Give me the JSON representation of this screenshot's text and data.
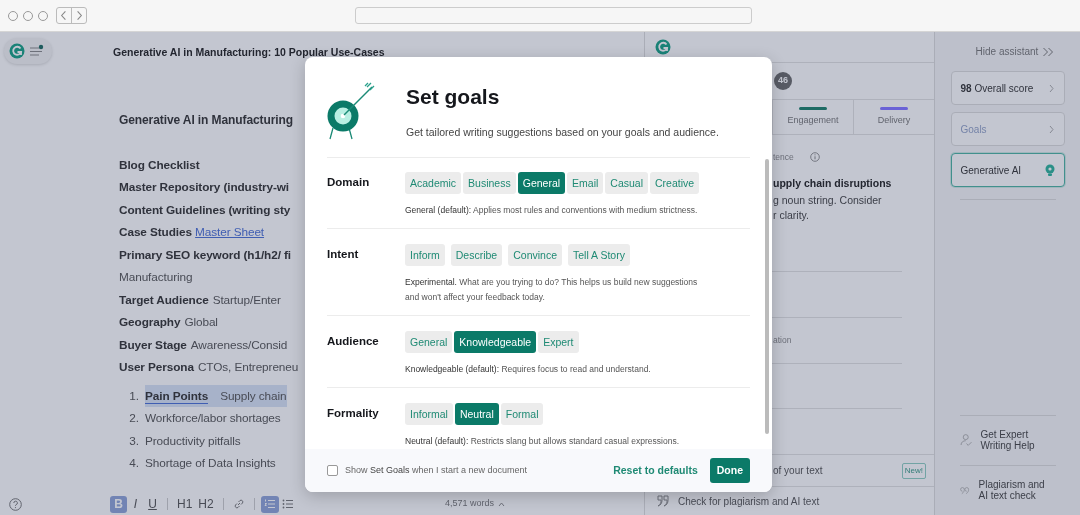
{
  "document": {
    "title": "Generative AI in Manufacturing: 10 Popular Use-Cases",
    "heading": "Generative AI in Manufacturing",
    "lines": [
      {
        "label": "Blog Checklist"
      },
      {
        "label": "Master Repository (industry-wi"
      },
      {
        "label": "Content Guidelines (writing sty"
      },
      {
        "label": "Case Studies",
        "link": "Master Sheet"
      },
      {
        "label": "Primary SEO keyword (h1/h2/ fi"
      },
      {
        "value": "Manufacturing"
      },
      {
        "label": "Target Audience",
        "value": "Startup/Enter"
      },
      {
        "label": "Geography",
        "value": "Global"
      },
      {
        "label": "Buyer Stage",
        "value": "Awareness/Consid"
      },
      {
        "label": "User Persona",
        "value": "CTOs, Entrepreneu"
      }
    ],
    "list": [
      {
        "number": "1.",
        "label": "Pain Points",
        "text": "Supply chain",
        "selected": true
      },
      {
        "number": "2.",
        "text": "Workforce/labor shortages",
        "selected": false
      },
      {
        "number": "3.",
        "text": "Productivity pitfalls",
        "selected": false
      },
      {
        "number": "4.",
        "text": "Shortage of Data Insights",
        "selected": false
      }
    ]
  },
  "format_buttons": [
    {
      "kind": "bold",
      "label": "B",
      "active": true
    },
    {
      "kind": "italic",
      "label": "I",
      "active": false
    },
    {
      "kind": "underline",
      "label": "U",
      "active": false
    },
    {
      "kind": "separator"
    },
    {
      "kind": "heading",
      "label": "H1",
      "active": false
    },
    {
      "kind": "heading",
      "label": "H2",
      "active": false
    },
    {
      "kind": "separator"
    },
    {
      "kind": "link",
      "active": false
    },
    {
      "kind": "separator"
    },
    {
      "kind": "numbered-list",
      "active": true
    },
    {
      "kind": "bulleted-list",
      "active": false
    }
  ],
  "word_count": "4,571 words",
  "assistant": {
    "count": "46",
    "tabs": [
      {
        "label": "Engagement",
        "color": "#1e6b64"
      },
      {
        "label": "Delivery",
        "color": "#6a62d6"
      }
    ],
    "card": {
      "category": "tence",
      "title": "upply chain disruptions",
      "body": [
        "g noun string. Consider",
        "r clarity."
      ]
    },
    "row_text": "ation",
    "feature": {
      "text": "of your text",
      "badge": "New!"
    },
    "plagiarism": "Check for plagiarism and AI text"
  },
  "sidebar": {
    "hide": "Hide assistant",
    "cards": [
      {
        "kind": "score",
        "score": "98",
        "label": "Overall score"
      },
      {
        "kind": "goals",
        "label": "Goals"
      },
      {
        "kind": "ai",
        "label": "Generative AI"
      }
    ],
    "links": [
      {
        "kind": "expert",
        "label": "Get Expert Writing Help"
      },
      {
        "kind": "plagiarism",
        "label": "Plagiarism and AI text check"
      }
    ]
  },
  "modal": {
    "title": "Set goals",
    "subtitle": "Get tailored writing suggestions based on your goals and audience.",
    "sections": [
      {
        "label": "Domain",
        "options": [
          {
            "label": "Academic",
            "selected": false
          },
          {
            "label": "Business",
            "selected": false
          },
          {
            "label": "General",
            "selected": true
          },
          {
            "label": "Email",
            "selected": false
          },
          {
            "label": "Casual",
            "selected": false
          },
          {
            "label": "Creative",
            "selected": false
          }
        ],
        "description": "**General (default):** Applies most rules and conventions with medium strictness."
      },
      {
        "label": "Intent",
        "options": [
          {
            "label": "Inform",
            "selected": false
          },
          {
            "label": "Describe",
            "selected": false
          },
          {
            "label": "Convince",
            "selected": false
          },
          {
            "label": "Tell A Story",
            "selected": false
          }
        ],
        "description": "**Experimental.** What are you trying to do? This helps us build new suggestions and won't affect your feedback today."
      },
      {
        "label": "Audience",
        "options": [
          {
            "label": "General",
            "selected": false
          },
          {
            "label": "Knowledgeable",
            "selected": true
          },
          {
            "label": "Expert",
            "selected": false
          }
        ],
        "description": "**Knowledgeable (default):** Requires focus to read and understand."
      },
      {
        "label": "Formality",
        "options": [
          {
            "label": "Informal",
            "selected": false
          },
          {
            "label": "Neutral",
            "selected": true
          },
          {
            "label": "Formal",
            "selected": false
          }
        ],
        "description": "**Neutral (default):** Restricts slang but allows standard casual expressions."
      }
    ],
    "checkbox": {
      "label": "Show **Set Goals** when I start a new document",
      "checked": false
    },
    "reset": "Reset to defaults",
    "done": "Done"
  }
}
